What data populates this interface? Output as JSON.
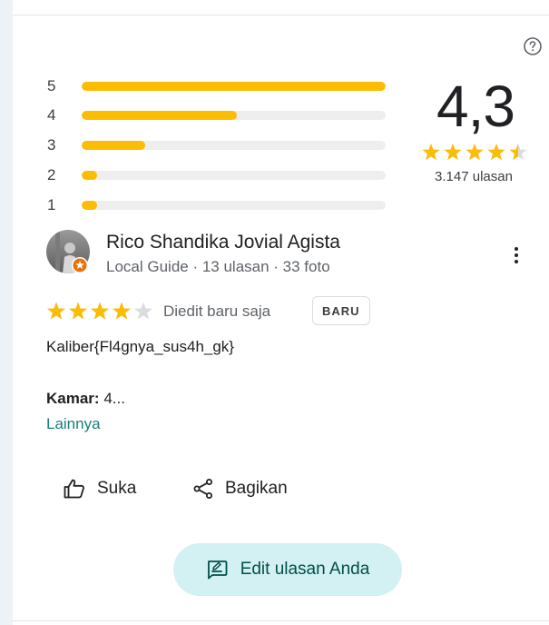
{
  "rating_summary": {
    "score": "4,3",
    "stars_filled": 4.5,
    "review_count": "3.147 ulasan",
    "distribution": [
      {
        "label": "5",
        "fraction": 1.0
      },
      {
        "label": "4",
        "fraction": 0.51
      },
      {
        "label": "3",
        "fraction": 0.21
      },
      {
        "label": "2",
        "fraction": 0.05
      },
      {
        "label": "1",
        "fraction": 0.05
      }
    ]
  },
  "review": {
    "author_name": "Rico Shandika Jovial Agista",
    "author_meta": "Local Guide · 13 ulasan · 33 foto",
    "stars": 4,
    "edited_text": "Diedit baru saja",
    "new_badge": "BARU",
    "text": "Kaliber{Fl4gnya_sus4h_gk}",
    "room_label": "Kamar:",
    "room_value": " 4...",
    "more_link": "Lainnya"
  },
  "actions": {
    "like_label": "Suka",
    "share_label": "Bagikan",
    "edit_label": "Edit ulasan Anda"
  },
  "colors": {
    "star": "#fbbc04",
    "star_empty": "#dadce0",
    "accent": "#1a8079",
    "edit_bg": "#d3f0f3"
  },
  "icons": [
    "help-icon",
    "local-guide-badge-icon",
    "more-vert-icon",
    "thumb-up-icon",
    "share-icon",
    "rate-review-icon"
  ]
}
